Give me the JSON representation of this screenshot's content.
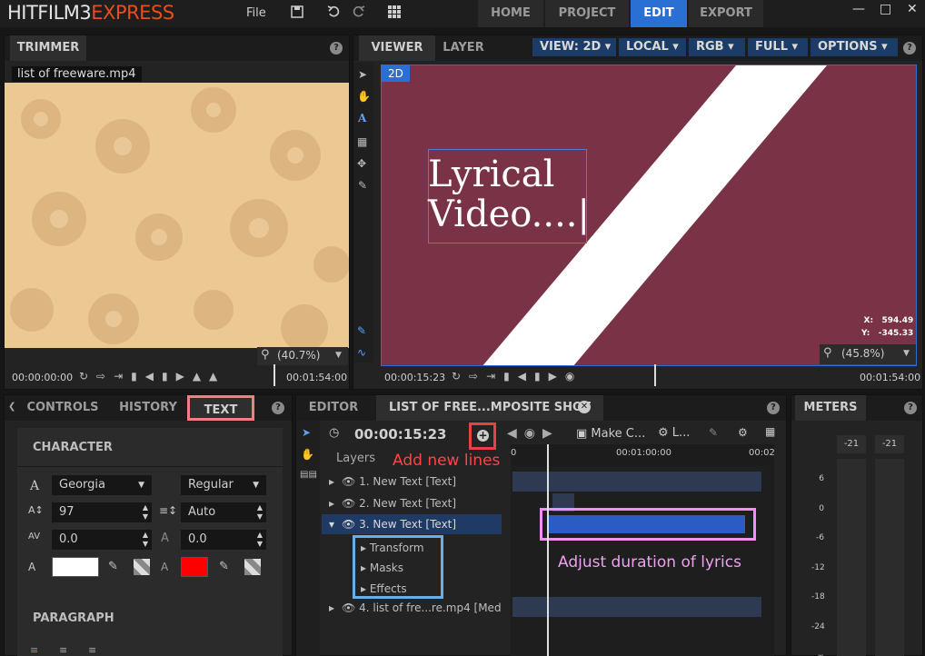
{
  "app": {
    "logo_main": "HITFILM3",
    "logo_express": "EXPRESS",
    "file_menu": "File",
    "tabs": [
      "HOME",
      "PROJECT",
      "EDIT",
      "EXPORT"
    ],
    "active_tab": "EDIT"
  },
  "trimmer": {
    "tab": "TRIMMER",
    "filename": "list of freeware.mp4",
    "zoom": "(40.7%)",
    "time_start": "00:00:00:00",
    "time_end": "00:01:54:00"
  },
  "viewer": {
    "tabs": [
      "VIEWER",
      "LAYER"
    ],
    "dropdowns": [
      "VIEW: 2D",
      "LOCAL",
      "RGB",
      "FULL",
      "OPTIONS"
    ],
    "badge": "2D",
    "canvas_text_line1": "Lyrical",
    "canvas_text_line2": "Video....|",
    "coord_x_label": "X:",
    "coord_x": "594.49",
    "coord_y_label": "Y:",
    "coord_y": "-345.33",
    "zoom": "(45.8%)",
    "time_start": "00:00:15:23",
    "time_end": "00:01:54:00"
  },
  "left_panel": {
    "tabs": [
      "CONTROLS",
      "HISTORY",
      "TEXT"
    ],
    "character_title": "CHARACTER",
    "font": "Georgia",
    "style": "Regular",
    "size": "97",
    "leading": "Auto",
    "tracking": "0.0",
    "baseline": "0.0",
    "fill_color": "#ffffff",
    "stroke_color": "#ff0000",
    "paragraph_title": "PARAGRAPH"
  },
  "editor": {
    "tabs": [
      "EDITOR",
      "LIST OF FREE...MPOSITE SHOT"
    ],
    "timecode": "00:00:15:23",
    "annotation_add": "Add new lines",
    "annotation_adjust": "Adjust duration of lyrics",
    "layers_label": "Layers",
    "make_comp": "Make C...",
    "l_label": "L...",
    "ruler": [
      "0",
      "00:01:00:00",
      "00:02"
    ],
    "layers": [
      "1. New Text [Text]",
      "2. New Text [Text]",
      "3. New Text [Text]",
      "4. list of fre...re.mp4 [Med"
    ],
    "sublayers": [
      "Transform",
      "Masks",
      "Effects"
    ]
  },
  "meters": {
    "tab": "METERS",
    "peak_left": "-21",
    "peak_right": "-21",
    "scale": [
      "6",
      "0",
      "-6",
      "-12",
      "-18",
      "-24",
      "-∞"
    ]
  },
  "colors": {
    "accent": "#2a6fd4",
    "canvas_bg": "#7a3346",
    "annotation_red": "#e8404a",
    "annotation_pink": "#f090f0",
    "annotation_blue": "#6aaee8"
  }
}
